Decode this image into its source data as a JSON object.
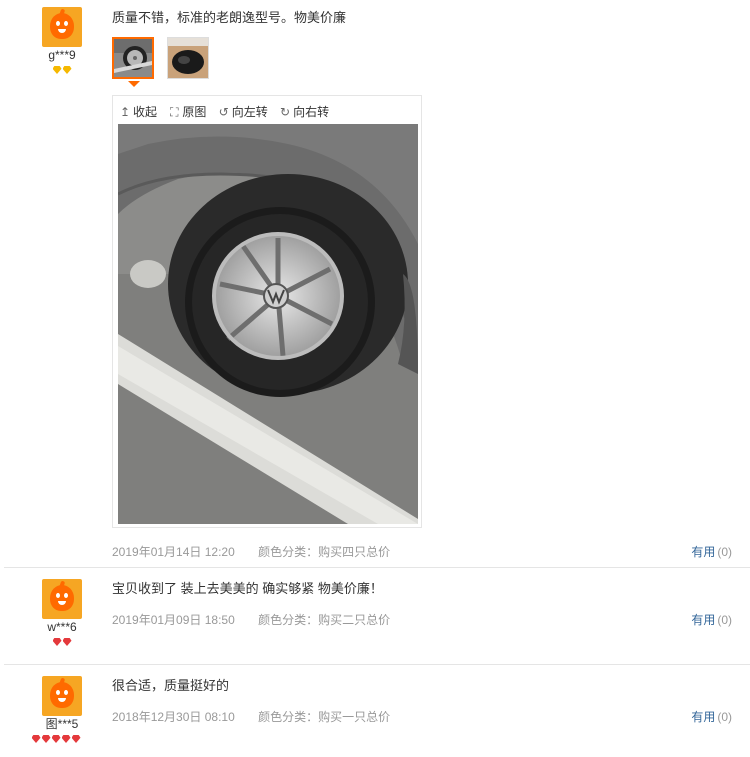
{
  "reviews": [
    {
      "user": "g***9",
      "badge_color": "gold",
      "content": "质量不错，标准的老朗逸型号。物美价廉",
      "date": "2019年01月14日 12:20",
      "color_label": "颜色分类：购买四只总价",
      "useful_label": "有用",
      "useful_count": "(0)"
    },
    {
      "user": "w***6",
      "badge_color": "red",
      "content": "宝贝收到了 装上去美美的 确实够紧 物美价廉！",
      "date": "2019年01月09日 18:50",
      "color_label": "颜色分类：购买二只总价",
      "useful_label": "有用",
      "useful_count": "(0)"
    },
    {
      "user": "图***5",
      "badge_color": "red",
      "content": "很合适，质量挺好的",
      "date": "2018年12月30日 08:10",
      "color_label": "颜色分类：购买一只总价",
      "useful_label": "有用",
      "useful_count": "(0)"
    }
  ],
  "viewer": {
    "collapse": "收起",
    "original": "原图",
    "rotate_left": "向左转",
    "rotate_right": "向右转",
    "icons": {
      "collapse": "arrow-up-icon",
      "original": "expand-icon",
      "rotate_left": "rotate-left-icon",
      "rotate_right": "rotate-right-icon"
    }
  },
  "colors": {
    "accent": "#ff6a00",
    "link": "#336699",
    "meta": "#999999"
  }
}
